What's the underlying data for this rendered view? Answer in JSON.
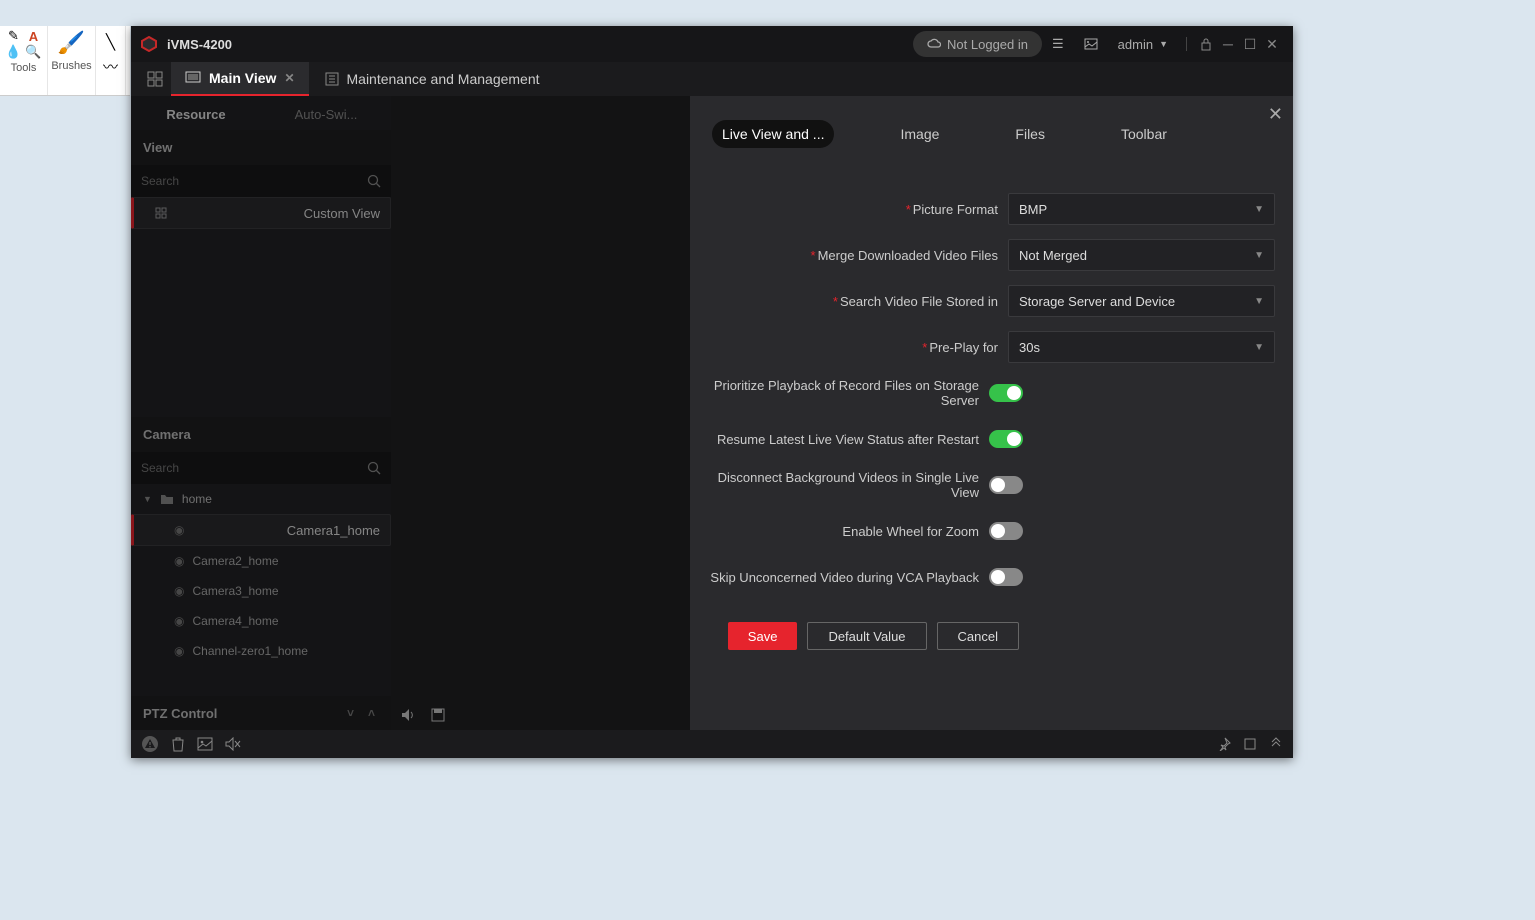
{
  "outer_ribbon": {
    "brushes_label": "Brushes",
    "tools_label": "Tools"
  },
  "window": {
    "title": "iVMS-4200",
    "login_status": "Not Logged in",
    "user": "admin"
  },
  "tabs": {
    "main_view": "Main View",
    "maintenance": "Maintenance and Management"
  },
  "sidebar": {
    "tab_resource": "Resource",
    "tab_autoswi": "Auto-Swi...",
    "panel_view": "View",
    "search_placeholder": "Search",
    "custom_view": "Custom View",
    "panel_camera": "Camera",
    "folder_home": "home",
    "cam1": "Camera1_home",
    "cam2": "Camera2_home",
    "cam3": "Camera3_home",
    "cam4": "Camera4_home",
    "cam5": "Channel-zero1_home",
    "ptz": "PTZ Control"
  },
  "dialog": {
    "tab_live": "Live View and ...",
    "tab_image": "Image",
    "tab_files": "Files",
    "tab_toolbar": "Toolbar",
    "picture_format_label": "Picture Format",
    "picture_format_value": "BMP",
    "merge_label": "Merge Downloaded Video Files",
    "merge_value": "Not Merged",
    "search_label": "Search Video File Stored in",
    "search_value": "Storage Server and Device",
    "preplay_label": "Pre-Play for",
    "preplay_value": "30s",
    "prioritize_label": "Prioritize Playback of Record Files on Storage Server",
    "resume_label": "Resume Latest Live View Status after Restart",
    "disconnect_label": "Disconnect Background Videos in Single Live View",
    "wheel_label": "Enable Wheel for Zoom",
    "skip_label": "Skip Unconcerned Video during VCA Playback",
    "toggles": {
      "prioritize": true,
      "resume": true,
      "disconnect": false,
      "wheel": false,
      "skip": false
    },
    "btn_save": "Save",
    "btn_default": "Default Value",
    "btn_cancel": "Cancel"
  }
}
